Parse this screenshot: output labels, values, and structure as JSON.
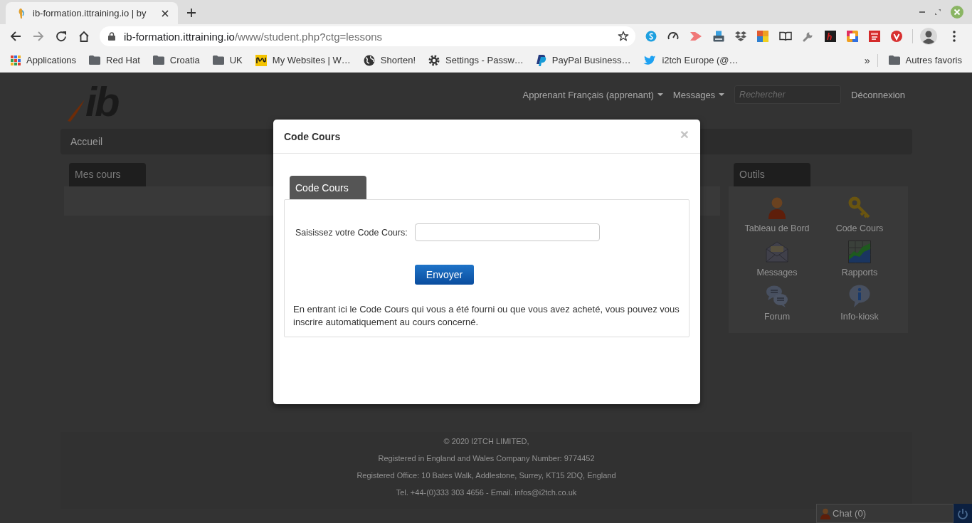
{
  "browser": {
    "tab": {
      "title": "ib-formation.ittraining.io | by",
      "selected": true
    },
    "address": {
      "host": "ib-formation.ittraining.io",
      "path": "/www/student.php?ctg=lessons"
    },
    "bookmarks": [
      {
        "label": "Applications",
        "kind": "apps"
      },
      {
        "label": "Red Hat",
        "kind": "folder"
      },
      {
        "label": "Croatia",
        "kind": "folder"
      },
      {
        "label": "UK",
        "kind": "folder"
      },
      {
        "label": "My Websites | W…",
        "kind": "site"
      },
      {
        "label": "Shorten!",
        "kind": "globe"
      },
      {
        "label": "Settings - Passw…",
        "kind": "gear"
      },
      {
        "label": "PayPal Business…",
        "kind": "pay"
      },
      {
        "label": "i2tch Europe (@…",
        "kind": "bird"
      }
    ],
    "overflow": "»",
    "other_bookmarks": "Autres favoris"
  },
  "page": {
    "logo": "ib",
    "user_menu": "Apprenant Français (apprenant)",
    "messages_menu": "Messages",
    "search": {
      "placeholder": "Rechercher"
    },
    "logout": "Déconnexion",
    "nav": [
      {
        "label": "Accueil"
      }
    ],
    "my_courses": {
      "title": "Mes cours"
    },
    "tools": {
      "title": "Outils",
      "items": [
        {
          "label": "Tableau de Bord",
          "kind": "dashboard"
        },
        {
          "label": "Code Cours",
          "kind": "key"
        },
        {
          "label": "Messages",
          "kind": "messages"
        },
        {
          "label": "Rapports",
          "kind": "reports"
        },
        {
          "label": "Forum",
          "kind": "forum"
        },
        {
          "label": "Info-kiosk",
          "kind": "info"
        }
      ]
    },
    "footer": [
      "© 2020 I2TCH LIMITED,",
      "Registered in England and Wales Company Number: 9774452",
      "Registered Office: 10 Bates Walk, Addlestone, Surrey, KT15 2DQ, England",
      "Tel. +44-(0)333 303 4656 - Email. infos@i2tch.co.uk"
    ],
    "chat": {
      "label": "Chat (0)"
    }
  },
  "modal": {
    "title": "Code Cours",
    "close": "×",
    "tabs": [
      {
        "label": "Code Cours",
        "selected": true
      }
    ],
    "field": {
      "label": "Saisissez votre Code Cours:"
    },
    "submit": "Envoyer",
    "note": "En entrant ici le Code Cours qui vous a été fourni ou que vous avez acheté, vous pouvez vous inscrire automatiquement au cours concerné."
  }
}
